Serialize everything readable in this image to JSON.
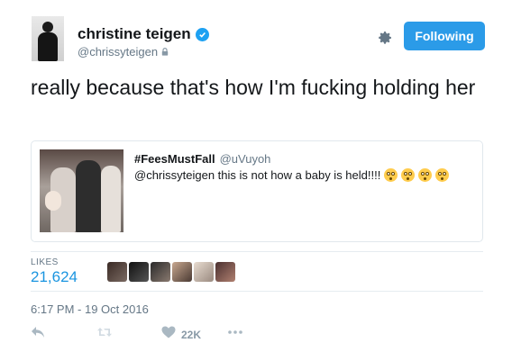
{
  "user": {
    "display_name": "christine teigen",
    "handle": "@chrissyteigen",
    "follow_label": "Following"
  },
  "tweet": {
    "text": "really because that's how I'm fucking holding her"
  },
  "quoted_tweet": {
    "display_name": "#FeesMustFall",
    "handle": "@uVuyoh",
    "text": "@chrissyteigen this is not how a baby is held!!!!"
  },
  "stats": {
    "likes_label": "LIKES",
    "likes_count": "21,624"
  },
  "timestamp": "6:17 PM - 19 Oct 2016",
  "actions": {
    "like_count": "22K"
  },
  "colors": {
    "accent": "#1da1f2",
    "follow_button": "#2b9be8",
    "muted_text": "#657786",
    "likes_count": "#1b95e0",
    "action_icon": "#aab8c2"
  },
  "icons": {
    "verified": "verified-badge-icon",
    "lock": "lock-icon",
    "settings": "gear-icon",
    "reply": "reply-icon",
    "retweet": "retweet-icon",
    "like": "heart-icon",
    "more": "more-icon"
  }
}
